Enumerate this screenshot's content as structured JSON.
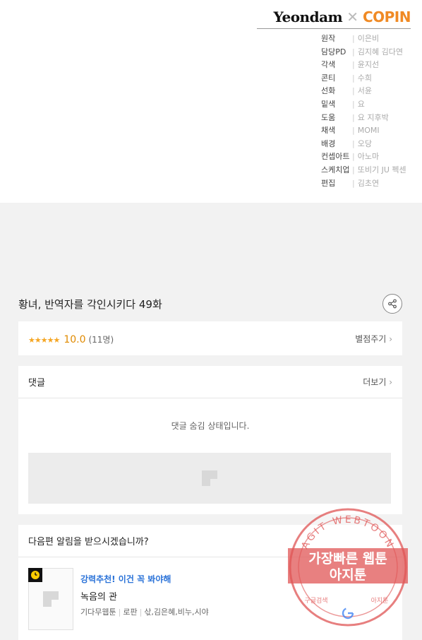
{
  "brand": {
    "left": "Yeondam",
    "right": "COPIN"
  },
  "credits": [
    {
      "role": "원작",
      "name": "이은비"
    },
    {
      "role": "담당PD",
      "name": "김지혜  김다연"
    },
    {
      "role": "각색",
      "name": "윤지선"
    },
    {
      "role": "콘티",
      "name": "수희"
    },
    {
      "role": "선화",
      "name": "서윤"
    },
    {
      "role": "밑색",
      "name": "요"
    },
    {
      "role": "도움",
      "name": "요  지후박"
    },
    {
      "role": "채색",
      "name": "MOMI"
    },
    {
      "role": "배경",
      "name": "오당"
    },
    {
      "role": "컨셉아트",
      "name": "아노마"
    },
    {
      "role": "스케치업",
      "name": "또비기  JU  펙센"
    },
    {
      "role": "편집",
      "name": "김초연"
    }
  ],
  "episode": {
    "title": "황녀, 반역자를 각인시키다 49화"
  },
  "rating": {
    "stars": "★★★★★",
    "score": "10.0",
    "count": "(11명)",
    "rate_label": "별점주기"
  },
  "comments": {
    "title": "댓글",
    "more_label": "더보기",
    "hidden_message": "댓글 숨김 상태입니다."
  },
  "notify": {
    "question": "다음편 알림을 받으시겠습니까?"
  },
  "recommend": {
    "tag": "강력추천! 이건 꼭 봐야해",
    "title": "녹음의 관",
    "meta": [
      "기다무웹툰",
      "로판",
      "삯,김은혜,비누,시야"
    ]
  },
  "watermark": {
    "top_text": "AGIT WEBTOON",
    "line1": "가장빠른 웹툰",
    "line2": "아지툰",
    "bottom_left": "구글검색",
    "bottom_right": "아지툰"
  },
  "colors": {
    "accent": "#f08a24",
    "star": "#f5a623",
    "link": "#2a72d8",
    "stamp": "#e05555"
  }
}
